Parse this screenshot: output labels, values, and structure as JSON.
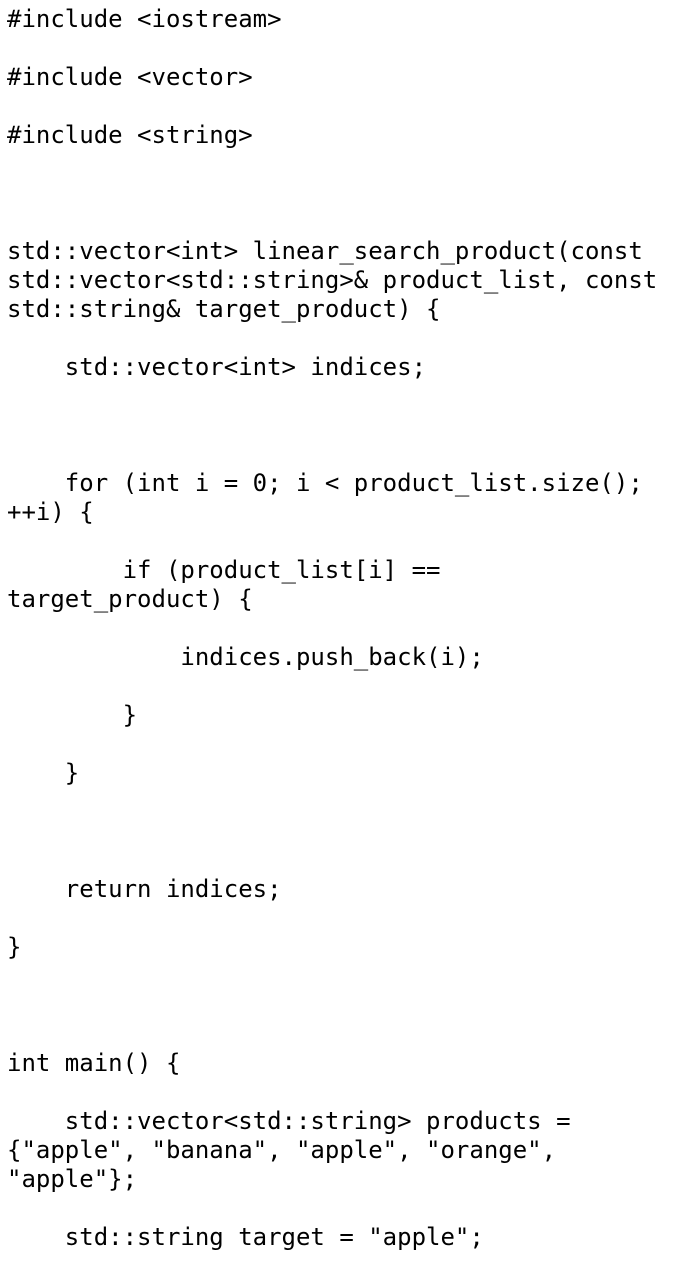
{
  "code_lines": [
    "#include <iostream>",
    "#include <vector>",
    "#include <string>",
    "std::vector<int> linear_search_product(const",
    "std::vector<std::string>& product_list, const",
    "std::string& target_product) {",
    "    std::vector<int> indices;",
    "    for (int i = 0; i < product_list.size();",
    "++i) {",
    "        if (product_list[i] ==",
    "target_product) {",
    "            indices.push_back(i);",
    "        }",
    "    }",
    "    return indices;",
    "}",
    "int main() {",
    "    std::vector<std::string> products =",
    "{\"apple\", \"banana\", \"apple\", \"orange\",",
    "\"apple\"};",
    "    std::string target = \"apple\";"
  ]
}
